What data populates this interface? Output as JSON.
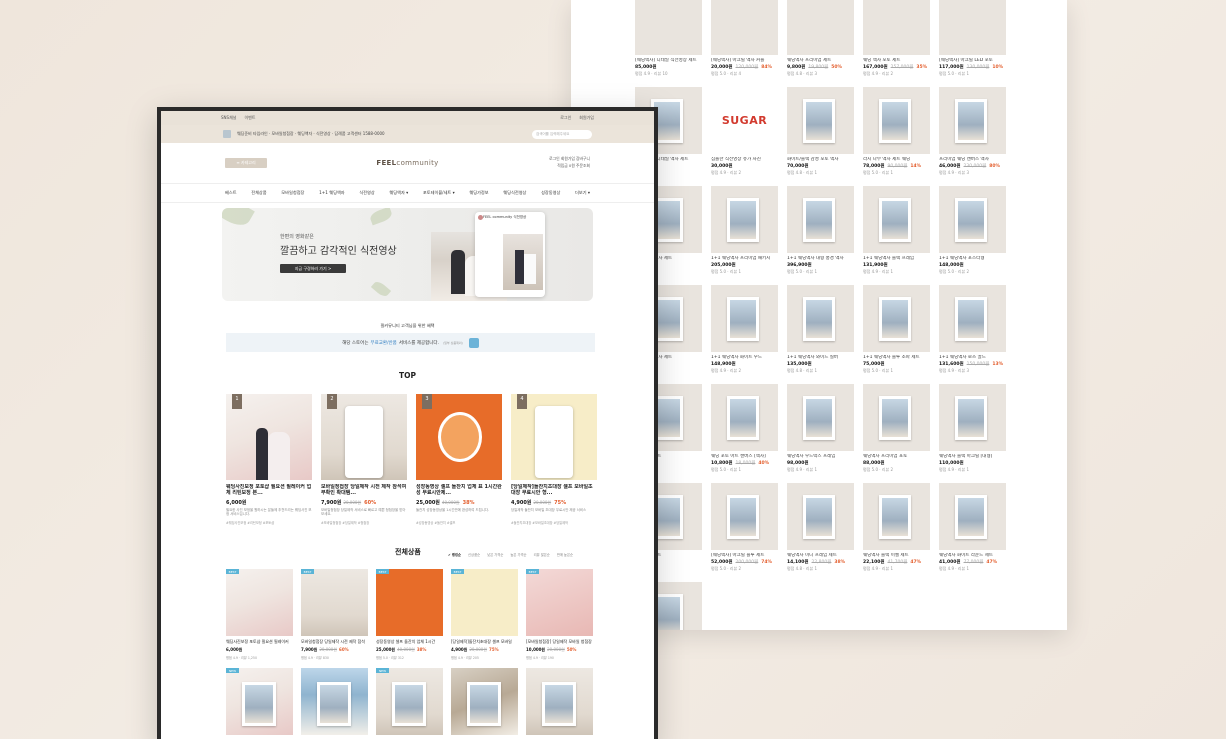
{
  "back_panel": {
    "rows": [
      [
        {
          "title": "[웨딩액자] 디테일 식전영상 세트",
          "price": "85,000원",
          "discount": "",
          "original": "",
          "review": "평점 4.9 · 리뷰 10"
        },
        {
          "title": "[웨딩액자] 아크릴 액자 커플",
          "price": "20,000원",
          "discount": "84%",
          "original": "120,000원",
          "review": "평점 5.0 · 리뷰 4"
        },
        {
          "title": "웨딩액자 프리미엄 세트",
          "price": "9,800원",
          "discount": "50%",
          "original": "19,800원",
          "review": "평점 4.8 · 리뷰 3"
        },
        {
          "title": "웨딩 액자 포토 세트",
          "price": "167,000원",
          "discount": "35%",
          "original": "257,000원",
          "review": "평점 4.9 · 리뷰 2"
        },
        {
          "title": "[웨딩액자] 아크릴 LED 포토",
          "price": "117,000원",
          "discount": "10%",
          "original": "130,000원",
          "review": "평점 5.0 · 리뷰 1"
        }
      ],
      [
        {
          "title": "[웨딩액자] 디테일 액자 세트",
          "price": "",
          "discount": "",
          "original": "",
          "review": ""
        },
        {
          "title": "심플한 식전영상 슈가 사진",
          "price": "30,000원",
          "discount": "",
          "original": "",
          "review": "평점 4.9 · 리뷰 2"
        },
        {
          "title": "화이트/블랙 감성 포토 액자",
          "price": "70,000원",
          "discount": "",
          "original": "",
          "review": "평점 4.8 · 리뷰 1"
        },
        {
          "title": "라지 나무 액자 세트 웨딩",
          "price": "78,000원",
          "discount": "14%",
          "original": "90,000원",
          "review": "평점 5.0 · 리뷰 1"
        },
        {
          "title": "프리미엄 웨딩 캔버스 액자",
          "price": "46,000원",
          "discount": "80%",
          "original": "230,000원",
          "review": "평점 4.9 · 리뷰 3"
        }
      ],
      [
        {
          "title": "1+1 웨딩액자 세트",
          "price": "",
          "discount": "",
          "original": "",
          "review": ""
        },
        {
          "title": "1+1 웨딩액자 프리미엄 패키지",
          "price": "205,000원",
          "discount": "",
          "original": "",
          "review": "평점 5.0 · 리뷰 1"
        },
        {
          "title": "1+1 웨딩액자 대형 풍경 액자",
          "price": "396,900원",
          "discount": "",
          "original": "",
          "review": "평점 5.0 · 리뷰 1"
        },
        {
          "title": "1+1 웨딩액자 블랙 프레임",
          "price": "131,900원",
          "discount": "",
          "original": "",
          "review": "평점 4.9 · 리뷰 1"
        },
        {
          "title": "1+1 웨딩액자 포스터형",
          "price": "148,000원",
          "discount": "",
          "original": "",
          "review": "평점 5.0 · 리뷰 2"
        }
      ],
      [
        {
          "title": "1+1 웨딩액자 세트",
          "price": "",
          "discount": "",
          "original": "",
          "review": ""
        },
        {
          "title": "1+1 웨딩액자 화이트 우드",
          "price": "148,900원",
          "discount": "",
          "original": "",
          "review": "평점 4.9 · 리뷰 2"
        },
        {
          "title": "1+1 웨딩액자 와이드 실버",
          "price": "135,000원",
          "discount": "",
          "original": "",
          "review": "평점 4.8 · 리뷰 1"
        },
        {
          "title": "1+1 웨딩액자 블루 소파 세트",
          "price": "75,000원",
          "discount": "",
          "original": "",
          "review": "평점 5.0 · 리뷰 1"
        },
        {
          "title": "1+1 웨딩액자 로즈 골드",
          "price": "131,600원",
          "discount": "13%",
          "original": "150,000원",
          "review": "평점 4.9 · 리뷰 3"
        }
      ],
      [
        {
          "title": "웨딩액자 세트",
          "price": "",
          "discount": "47%",
          "original": "",
          "review": ""
        },
        {
          "title": "웨딩 포토 아트 캔버스 [액자]",
          "price": "10,800원",
          "discount": "40%",
          "original": "18,000원",
          "review": "평점 5.0 · 리뷰 1"
        },
        {
          "title": "웨딩액자 우드박스 프레임",
          "price": "98,000원",
          "discount": "",
          "original": "",
          "review": "평점 4.9 · 리뷰 1"
        },
        {
          "title": "웨딩액자 프리미엄 포토",
          "price": "88,000원",
          "discount": "",
          "original": "",
          "review": "평점 5.0 · 리뷰 2"
        },
        {
          "title": "웨딩액자 블랙 아크릴 [대형]",
          "price": "110,000원",
          "discount": "",
          "original": "",
          "review": "평점 4.9 · 리뷰 1"
        }
      ],
      [
        {
          "title": "웨딩액자 세트",
          "price": "",
          "discount": "",
          "original": "",
          "review": ""
        },
        {
          "title": "[웨딩액자] 아크릴 블루 세트",
          "price": "52,000원",
          "discount": "74%",
          "original": "200,000원",
          "review": "평점 5.0 · 리뷰 2"
        },
        {
          "title": "웨딩액자 미니 프레임 세트",
          "price": "14,100원",
          "discount": "38%",
          "original": "22,800원",
          "review": "평점 4.8 · 리뷰 1"
        },
        {
          "title": "웨딩액자 블랙 이젤 세트",
          "price": "22,100원",
          "discount": "47%",
          "original": "41,700원",
          "review": "평점 4.9 · 리뷰 1"
        },
        {
          "title": "웨딩액자 화이트 라운드 세트",
          "price": "41,000원",
          "discount": "47%",
          "original": "77,000원",
          "review": "평점 4.9 · 리뷰 1"
        }
      ],
      [
        {
          "title": "웨딩액자 세트",
          "price": "",
          "discount": "23%",
          "original": "",
          "review": ""
        }
      ]
    ],
    "sugar_text": "SUGAR"
  },
  "front": {
    "topbar": {
      "left1": "SNS채널",
      "left2": "이벤트",
      "right1": "로그인",
      "right2": "회원가입"
    },
    "notice": {
      "text": "웨딩준비 타임라인 · 모바일청첩장 · 웨딩액자 · 식전영상 · 답례품 고객센터 1588-0000",
      "search_placeholder": "검색어를 입력해주세요"
    },
    "header": {
      "category_button": "≡ 카테고리",
      "logo_main": "FEEL",
      "logo_sub": "community",
      "user_line1": "로그인   회원가입   장바구니",
      "user_line2": "적립금 0원   주문조회"
    },
    "nav": [
      "베스트",
      "전체상품",
      "모바일청첩장",
      "1+1 웨딩액자",
      "식전영상",
      "웨딩액자 ▾",
      "포토테이블/세트 ▾",
      "웨딩가정보",
      "웨딩식전영상",
      "성장동영상",
      "더보기 ▾"
    ],
    "banner": {
      "small": "한편의 영화같은",
      "big": "깔끔하고 감각적인 식전영상",
      "button": "지금 구경하러 가기 >",
      "phone_title": "FEEL community 식전영상"
    },
    "subhead": "필커뮤니티 고객님을 위한 혜택",
    "freebar": {
      "pre": "해당 스토어는",
      "highlight": "무료교환/반품",
      "post": "서비스를 제공합니다.",
      "tiny": "(일부 상품제외)"
    },
    "top_title": "TOP",
    "top_items": [
      {
        "rank": "1",
        "title": "웨딩사진보정 포토샵 필요션 필레이커 업체 리틴보정 본...",
        "price": "6,000원",
        "original": "",
        "discount": "",
        "desc": "필요한 사진 보정을 원하시는 분들께 추천드리는 웨딩사진 보정 서비스입니다.",
        "tags": "#웨딩사진보정 #리틴보정 #포토샵"
      },
      {
        "rank": "2",
        "title": "모바일청첩장 당일제작 시전 제작 참석여부확인 확대탬...",
        "price": "7,900원",
        "original": "20,000원",
        "discount": "60%",
        "desc": "모바일청첩장 당일제작 서비스로 빠르고 예쁜 청첩장을 받아보세요.",
        "tags": "#모바일청첩장 #당일제작 #청첩장"
      },
      {
        "rank": "3",
        "title": "성장동영상 셀프 돌잔치 업체 표 1시간완성 무료시안제...",
        "price": "25,000원",
        "original": "40,000원",
        "discount": "38%",
        "desc": "돌잔치 성장동영상을 1시간만에 완성하여 드립니다.",
        "tags": "#성장동영상 #돌잔치 #셀프"
      },
      {
        "rank": "4",
        "title": "[당일제작]돌잔치초대장 셀프 모바일초대장 무료시안 형...",
        "price": "4,900원",
        "original": "20,000원",
        "discount": "75%",
        "desc": "당일제작 돌잔치 모바일 초대장 무료시안 제공 서비스",
        "tags": "#돌잔치초대장 #모바일초대장 #당일제작"
      }
    ],
    "all_title": "전체상품",
    "sorts": [
      "✔ 랭킹순",
      "신상품순",
      "낮은 가격순",
      "높은 가격순",
      "리뷰 많은순",
      "판매 높은순"
    ],
    "all_items": [
      {
        "badge": "BEST",
        "title": "웨딩사진보정 포토샵 필요션 필레이커",
        "price": "6,000원",
        "original": "",
        "discount": "",
        "review": "평점 4.9 · 리뷰 1,250"
      },
      {
        "badge": "BEST",
        "title": "모바일청첩장 당일제작 시전 제작 참석",
        "price": "7,900원",
        "original": "20,000원",
        "discount": "60%",
        "review": "평점 4.9 · 리뷰 830"
      },
      {
        "badge": "BEST",
        "title": "성장동영상 셀프 돌잔치 업체 1시간",
        "price": "25,000원",
        "original": "40,000원",
        "discount": "38%",
        "review": "평점 5.0 · 리뷰 312"
      },
      {
        "badge": "BEST",
        "title": "[당일제작]돌잔치초대장 셀프 모바일",
        "price": "4,900원",
        "original": "20,000원",
        "discount": "75%",
        "review": "평점 4.9 · 리뷰 205"
      },
      {
        "badge": "BEST",
        "title": "[모바일청첩장] 당일제작 모바일 청첩장",
        "price": "10,000원",
        "original": "20,000원",
        "discount": "50%",
        "review": "평점 4.9 · 리뷰 190"
      }
    ],
    "all_items_row2": [
      {
        "badge": "NEW"
      },
      {
        "badge": ""
      },
      {
        "badge": "NEW"
      },
      {
        "badge": ""
      },
      {
        "badge": ""
      }
    ]
  },
  "colors": {
    "accent_discount": "#e35d2c",
    "badge_blue": "#5ab4d6",
    "brand_beige": "#d8cfc3"
  }
}
